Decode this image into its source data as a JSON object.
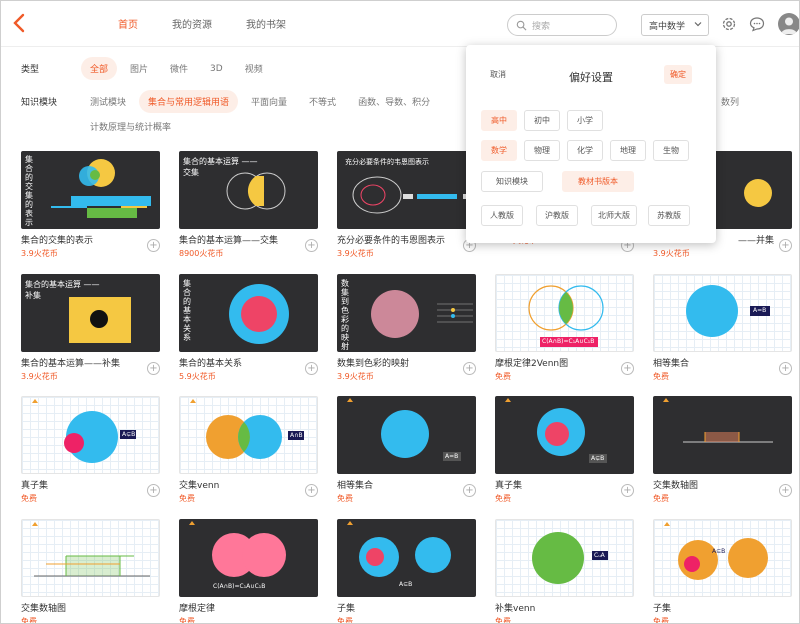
{
  "nav": {
    "tabs": [
      "首页",
      "我的资源",
      "我的书架"
    ],
    "active": 0
  },
  "search": {
    "placeholder": "搜索"
  },
  "grade": {
    "selected": "高中数学"
  },
  "filters": {
    "type_label": "类型",
    "types": [
      "全部",
      "图片",
      "微件",
      "3D",
      "视频"
    ],
    "module_label": "知识模块",
    "modules": [
      "测试模块",
      "集合与常用逻辑用语",
      "平面向量",
      "不等式",
      "函数、导数、积分"
    ],
    "modules_row2": [
      "计数原理与统计概率"
    ],
    "modules_extra": "数列"
  },
  "cards": [
    {
      "title": "集合的交集的表示",
      "price": "3.9火花币",
      "thumb_text": "集合的交集的表示"
    },
    {
      "title": "集合的基本运算——交集",
      "price": "8900火花币",
      "thumb_text": "集合的基本运算 ——交集"
    },
    {
      "title": "充分必要条件的韦恩图表示",
      "price": "3.9火花币",
      "thumb_text": "充分必要条件的韦恩图表示"
    },
    {
      "title": "",
      "price": "12.9火花币"
    },
    {
      "title": "——并集",
      "price": "3.9火花币"
    },
    {
      "title": "集合的基本运算——补集",
      "price": "3.9火花币",
      "thumb_text": "集合的基本运算 ——补集"
    },
    {
      "title": "集合的基本关系",
      "price": "5.9火花币",
      "thumb_text": "集合的基本关系"
    },
    {
      "title": "数集到色彩的映射",
      "price": "3.9火花币",
      "thumb_text": "数集到色彩的映射"
    },
    {
      "title": "摩根定律2Venn图",
      "price": "免费",
      "thumb_text": "C(A∩B)=C₁A∪C₁B"
    },
    {
      "title": "相等集合",
      "price": "免费",
      "thumb_text": "A=B"
    },
    {
      "title": "真子集",
      "price": "免费",
      "thumb_text": "A⊊B"
    },
    {
      "title": "交集venn",
      "price": "免费",
      "thumb_text": "A∩B"
    },
    {
      "title": "相等集合",
      "price": "免费",
      "thumb_text": "A=B"
    },
    {
      "title": "真子集",
      "price": "免费",
      "thumb_text": "A⊊B"
    },
    {
      "title": "交集数轴图",
      "price": "免费"
    },
    {
      "title": "交集数轴图",
      "price": "免费"
    },
    {
      "title": "摩根定律",
      "price": "免费",
      "thumb_text": "C(A∩B)=C₁A∪C₁B"
    },
    {
      "title": "子集",
      "price": "免费",
      "thumb_text": "A⊆B"
    },
    {
      "title": "补集venn",
      "price": "免费",
      "thumb_text": "CᵤA"
    },
    {
      "title": "子集",
      "price": "免费",
      "thumb_text": "A⊆B"
    }
  ],
  "panel": {
    "title": "偏好设置",
    "cancel": "取消",
    "confirm": "确定",
    "stages": [
      "高中",
      "初中",
      "小学"
    ],
    "subjects": [
      "数学",
      "物理",
      "化学",
      "地理",
      "生物"
    ],
    "module_mode": [
      "知识模块",
      "教材书版本"
    ],
    "editions": [
      "人教版",
      "沪教版",
      "北师大版",
      "苏教版"
    ]
  },
  "colors": {
    "accent": "#f05a28",
    "yellow": "#f5c842",
    "blue": "#33bbee",
    "pink": "#ee4466",
    "orange": "#f0a030",
    "green": "#66bb44"
  }
}
